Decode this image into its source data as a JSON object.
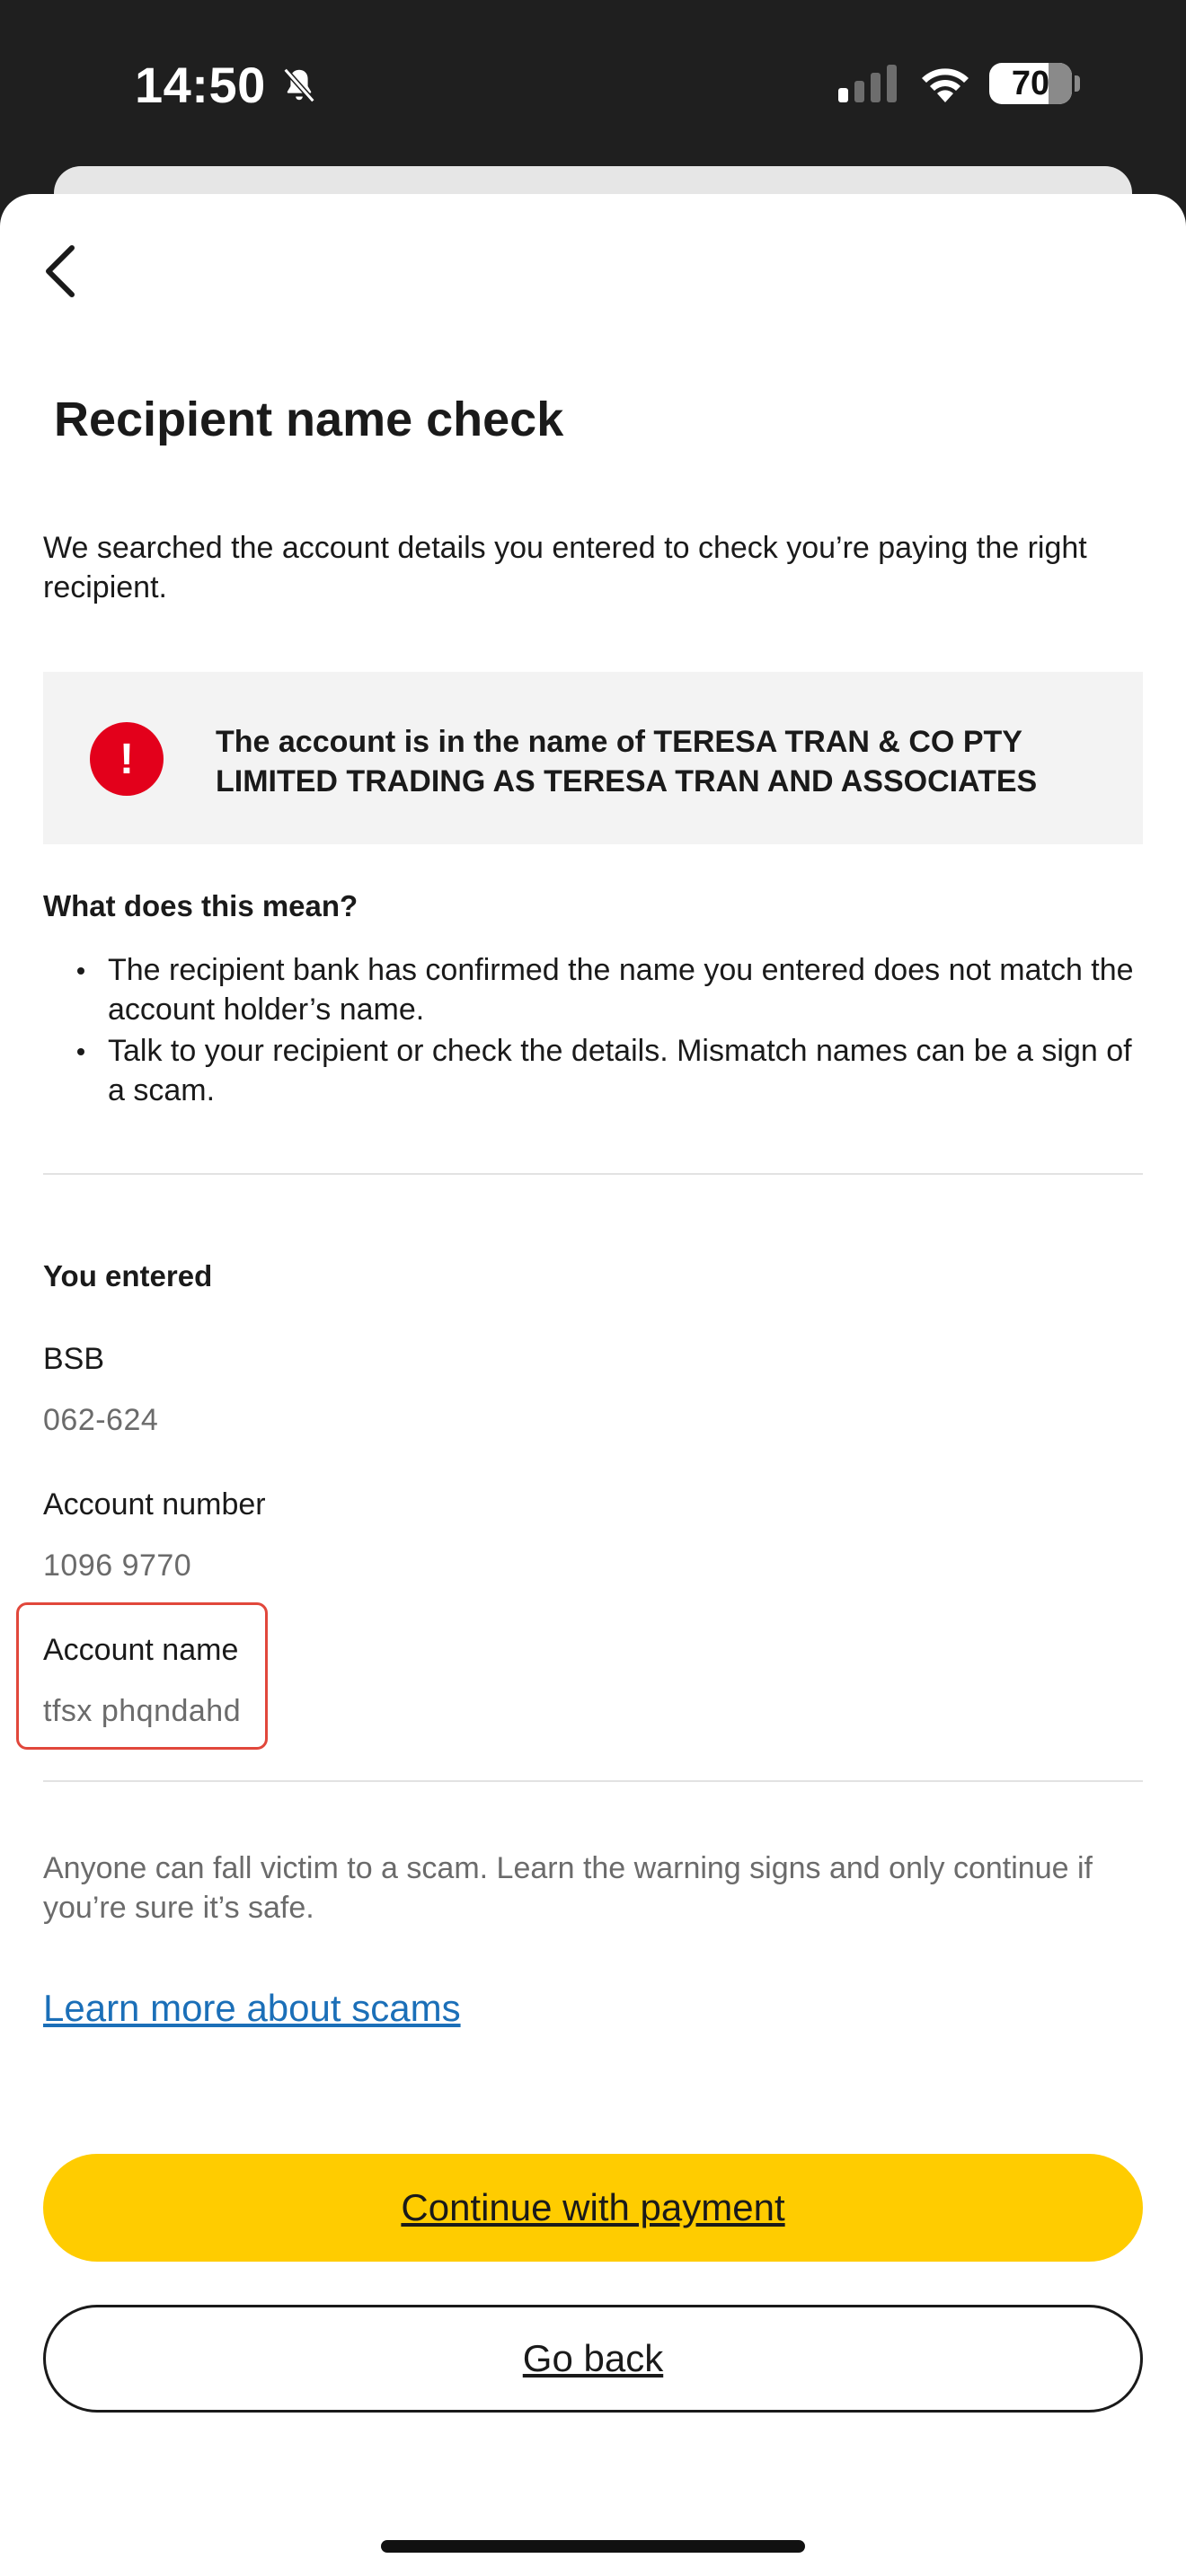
{
  "status_bar": {
    "time": "14:50",
    "battery_level": "70",
    "silent_mode_icon": "bell-slash-icon",
    "signal_icon": "cellular-signal-icon",
    "wifi_icon": "wifi-icon"
  },
  "header": {
    "back_icon": "chevron-left-icon",
    "title": "Recipient name check"
  },
  "intro_text": "We searched the account details you entered to check you’re paying the right recipient.",
  "alert": {
    "icon": "exclamation-circle-icon",
    "icon_glyph": "!",
    "icon_color": "#e3001b",
    "message": "The account is in the name of TERESA TRAN & CO PTY LIMITED TRADING AS TERESA TRAN AND ASSOCIATES"
  },
  "meaning": {
    "heading": "What does this mean?",
    "bullets": [
      "The recipient bank has confirmed the name you entered does not match the account holder’s name.",
      "Talk to your recipient or check the details. Mismatch names can be a sign of a scam."
    ]
  },
  "entered": {
    "heading": "You entered",
    "bsb_label": "BSB",
    "bsb_value": "062-624",
    "account_number_label": "Account number",
    "account_number_value": "1096 9770",
    "account_name_label": "Account name",
    "account_name_value": "tfsx phqndahd"
  },
  "disclaimer": "Anyone can fall victim to a scam. Learn the warning signs and only continue if you’re sure it’s safe.",
  "learn_more_link": "Learn more about scams",
  "buttons": {
    "continue_label": "Continue with payment",
    "go_back_label": "Go back"
  },
  "colors": {
    "primary_button": "#ffcc00",
    "link": "#1b6fb8",
    "alert_red": "#e3001b",
    "highlight_border": "#e1473b"
  }
}
